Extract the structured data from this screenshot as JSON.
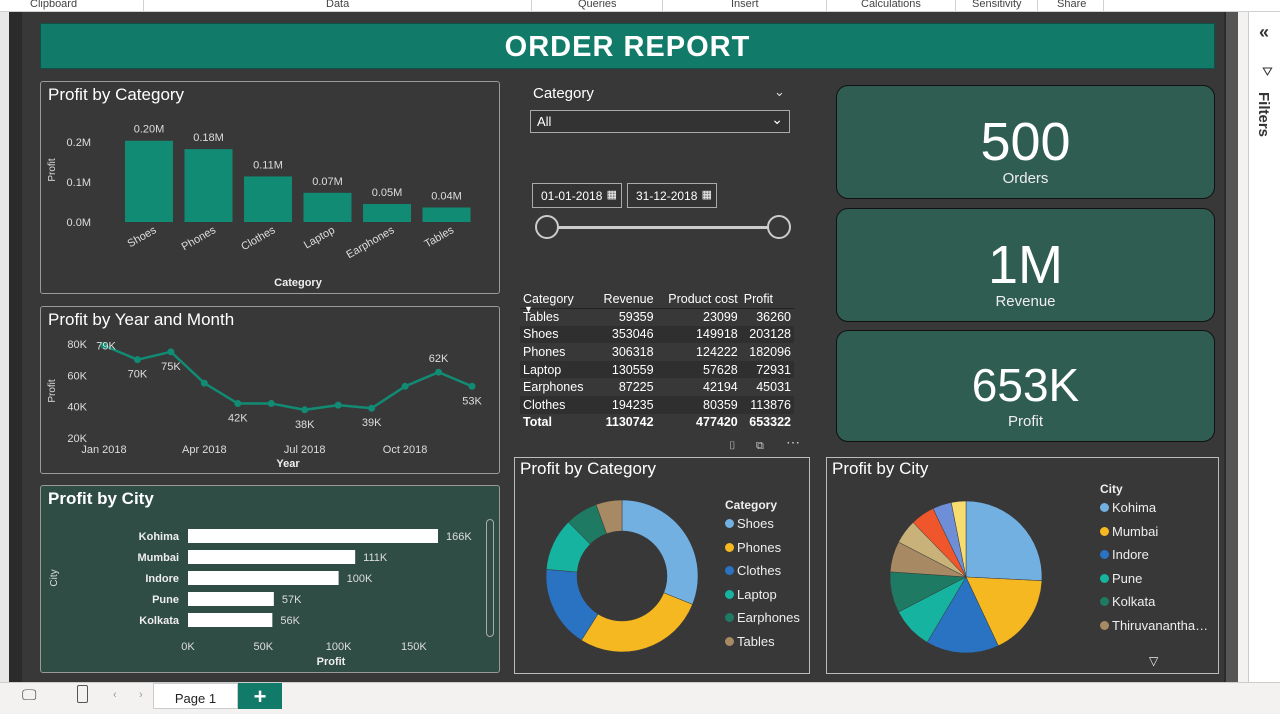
{
  "ribbon": {
    "groups": [
      "Clipboard",
      "Data",
      "Queries",
      "Insert",
      "Calculations",
      "Sensitivity",
      "Share"
    ]
  },
  "filters_pane": {
    "label": "Filters",
    "collapse_icon": "double-chevron-left-icon",
    "filter_icon": "funnel-icon"
  },
  "report": {
    "title": "ORDER REPORT"
  },
  "category_slicer": {
    "label": "Category",
    "selected": "All"
  },
  "date_slicer": {
    "start": "01-01-2018",
    "end": "31-12-2018"
  },
  "kpis": [
    {
      "value": "500",
      "label": "Orders"
    },
    {
      "value": "1M",
      "label": "Revenue"
    },
    {
      "value": "653K",
      "label": "Profit"
    }
  ],
  "table": {
    "headers": [
      "Category",
      "Revenue",
      "Product cost",
      "Profit"
    ],
    "rows": [
      [
        "Tables",
        "59359",
        "23099",
        "36260"
      ],
      [
        "Shoes",
        "353046",
        "149918",
        "203128"
      ],
      [
        "Phones",
        "306318",
        "124222",
        "182096"
      ],
      [
        "Laptop",
        "130559",
        "57628",
        "72931"
      ],
      [
        "Earphones",
        "87225",
        "42194",
        "45031"
      ],
      [
        "Clothes",
        "194235",
        "80359",
        "113876"
      ]
    ],
    "total": [
      "Total",
      "1130742",
      "477420",
      "653322"
    ]
  },
  "colors": {
    "accent": "#127a68",
    "bar": "#118b74",
    "white_bar": "#ffffff"
  },
  "chart_data": [
    {
      "id": "profit_by_category_bar",
      "type": "bar",
      "title": "Profit by Category",
      "xlabel": "Category",
      "ylabel": "Profit",
      "categories": [
        "Shoes",
        "Phones",
        "Clothes",
        "Laptop",
        "Earphones",
        "Tables"
      ],
      "values": [
        203128,
        182096,
        113876,
        72931,
        45031,
        36260
      ],
      "data_labels": [
        "0.20M",
        "0.18M",
        "0.11M",
        "0.07M",
        "0.05M",
        "0.04M"
      ],
      "yticks": [
        "0.0M",
        "0.1M",
        "0.2M"
      ],
      "ylim": [
        0,
        250000
      ]
    },
    {
      "id": "profit_by_year_month_line",
      "type": "line",
      "title": "Profit by Year and Month",
      "xlabel": "Year",
      "ylabel": "Profit",
      "x": [
        "Jan 2018",
        "Feb 2018",
        "Mar 2018",
        "Apr 2018",
        "May 2018",
        "Jun 2018",
        "Jul 2018",
        "Aug 2018",
        "Sep 2018",
        "Oct 2018",
        "Nov 2018",
        "Dec 2018"
      ],
      "values": [
        79,
        70,
        75,
        55,
        42,
        42,
        38,
        41,
        39,
        53,
        62,
        53
      ],
      "data_labels": [
        "79K",
        "70K",
        "75K",
        "",
        "42K",
        "",
        "38K",
        "",
        "39K",
        "",
        "62K",
        "53K"
      ],
      "xticks": [
        "Jan 2018",
        "Apr 2018",
        "Jul 2018",
        "Oct 2018"
      ],
      "yticks": [
        "20K",
        "40K",
        "60K",
        "80K"
      ],
      "ylim": [
        20,
        80
      ]
    },
    {
      "id": "profit_by_city_bar",
      "type": "bar",
      "orientation": "horizontal",
      "title": "Profit by City",
      "xlabel": "Profit",
      "ylabel": "City",
      "categories": [
        "Kohima",
        "Mumbai",
        "Indore",
        "Pune",
        "Kolkata"
      ],
      "values": [
        166,
        111,
        100,
        57,
        56
      ],
      "data_labels": [
        "166K",
        "111K",
        "100K",
        "57K",
        "56K"
      ],
      "xticks": [
        "0K",
        "50K",
        "100K",
        "150K"
      ],
      "xlim": [
        0,
        180
      ]
    },
    {
      "id": "profit_by_category_donut",
      "type": "pie",
      "title": "Profit by Category",
      "legend_title": "Category",
      "categories": [
        "Shoes",
        "Phones",
        "Clothes",
        "Laptop",
        "Earphones",
        "Tables"
      ],
      "values": [
        203128,
        182096,
        113876,
        72931,
        45031,
        36260
      ],
      "colors": [
        "#72b0e2",
        "#f5b820",
        "#2a73c2",
        "#15b3a0",
        "#1f7a63",
        "#a78963"
      ]
    },
    {
      "id": "profit_by_city_pie",
      "type": "pie",
      "title": "Profit by City",
      "legend_title": "City",
      "categories": [
        "Kohima",
        "Mumbai",
        "Indore",
        "Pune",
        "Kolkata",
        "Thiruvanantha…",
        "",
        "",
        "",
        ""
      ],
      "values": [
        166,
        111,
        100,
        57,
        56,
        42,
        33,
        33,
        26,
        20
      ],
      "colors": [
        "#72b0e2",
        "#f5b820",
        "#2a73c2",
        "#15b3a0",
        "#1f7a63",
        "#a78963",
        "#c8b27a",
        "#f0562c",
        "#6e8fd8",
        "#f7dc6f"
      ]
    }
  ],
  "pages": {
    "current": "Page 1",
    "add_label": "+"
  }
}
